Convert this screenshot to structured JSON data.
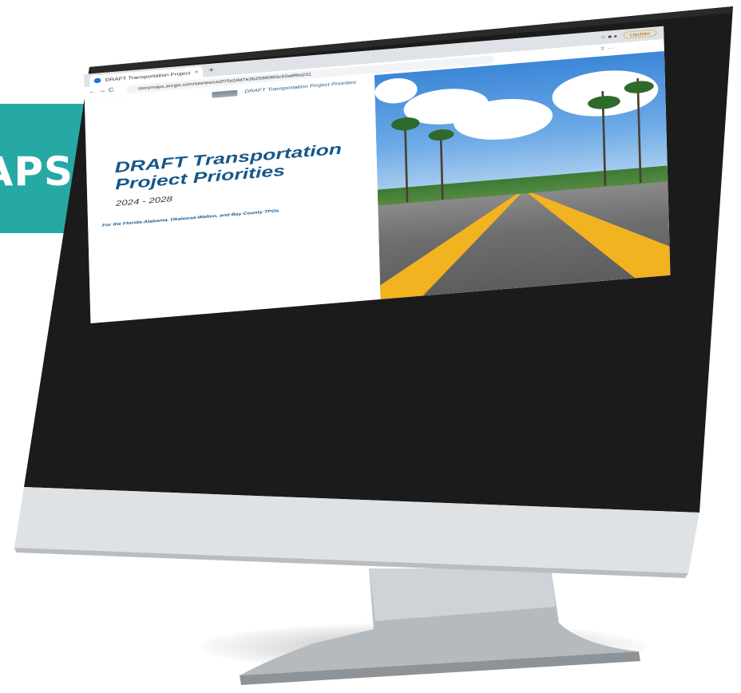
{
  "banner": {
    "text": "APS"
  },
  "browser": {
    "tab_label": "DRAFT Transportation Project",
    "new_tab_symbol": "+",
    "close_symbol": "×",
    "nav_symbols": "← → C",
    "url": "storymaps.arcgis.com/stories/ce2f75d19d7e3b25980f83c50a6f8a231",
    "addr_right": "⇧  ···",
    "update_label": "Update"
  },
  "story": {
    "header_title": "DRAFT Transportation Project Priorities",
    "title": "DRAFT Transportation Project Priorities",
    "years": "2024 - 2028",
    "subtitle": "For the Florida-Alabama, Okaloosa-Walton, and Bay County TPOs"
  },
  "colors": {
    "teal": "#26a9a5",
    "title_blue": "#15578a",
    "bezel": "#1b1b1b",
    "chin": "#d9dcdf",
    "stand": "#b9bec3",
    "road_line": "#f2b321"
  }
}
